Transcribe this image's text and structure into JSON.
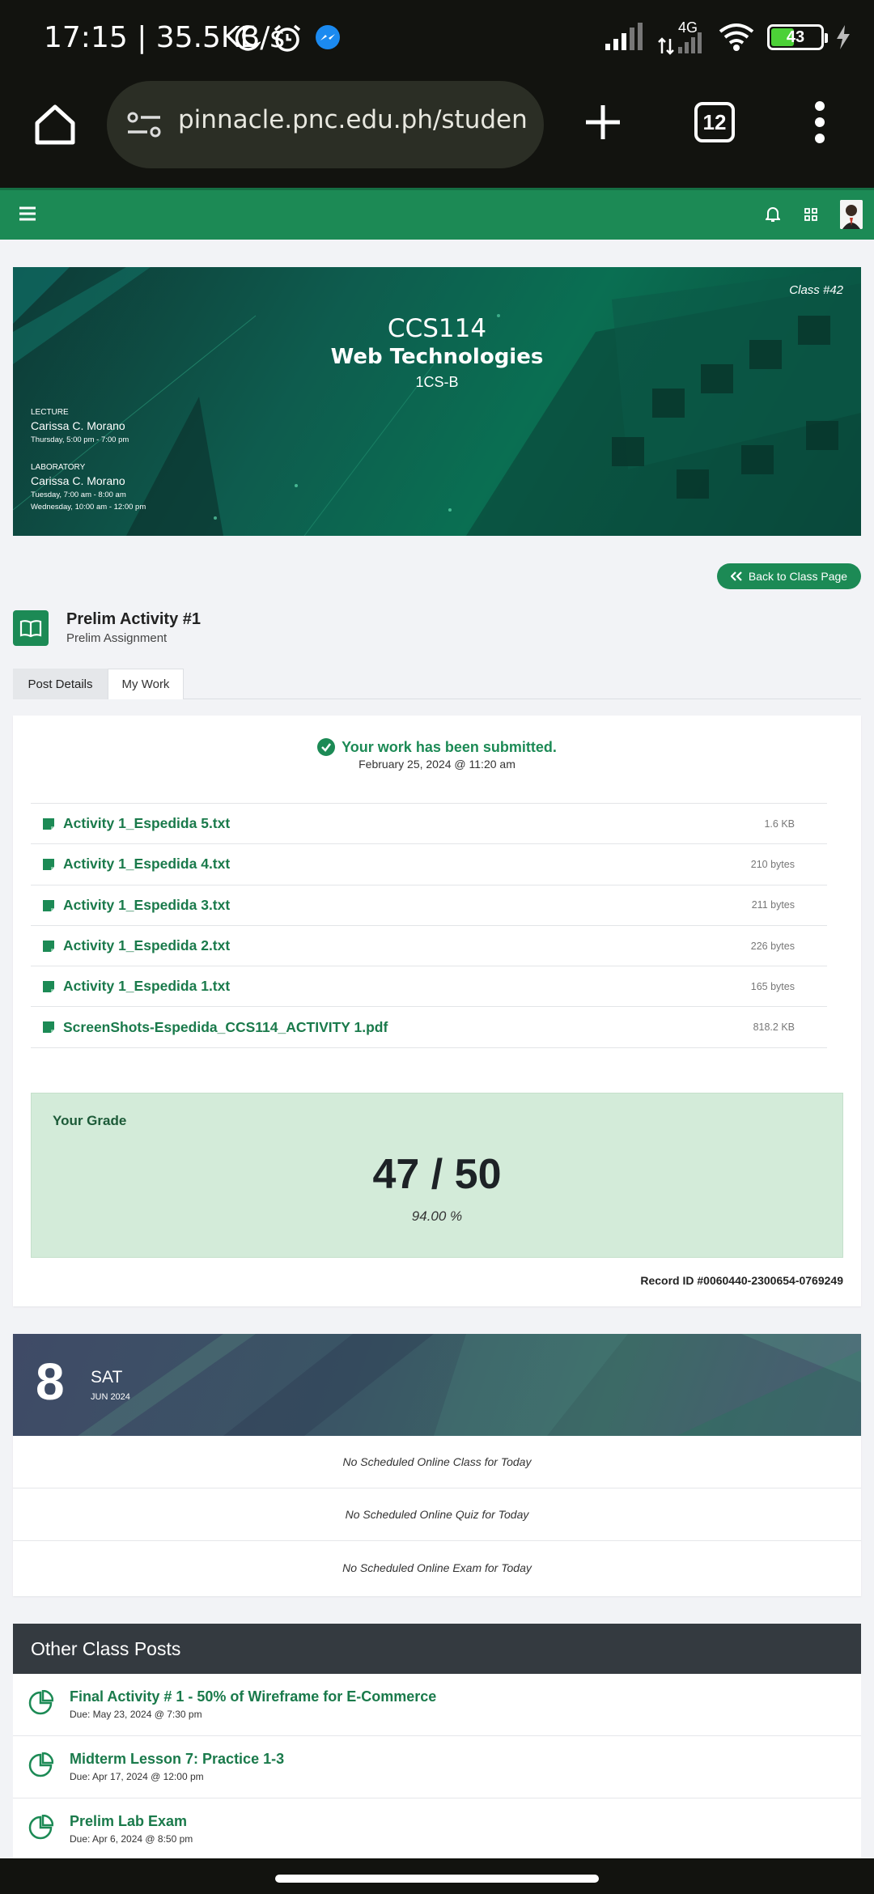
{
  "status_bar": {
    "time_speed": "17:15 | 35.5KB/s",
    "network": "4G",
    "battery": "43"
  },
  "browser": {
    "url": "pinnacle.pnc.edu.ph/student/pos",
    "tab_count": "12"
  },
  "banner": {
    "class_number": "Class #42",
    "course_code": "CCS114",
    "course_title": "Web Technologies",
    "section": "1CS-B",
    "lecture_label": "LECTURE",
    "lecture_teacher": "Carissa C. Morano",
    "lecture_schedule": "Thursday, 5:00 pm - 7:00 pm",
    "lab_label": "LABORATORY",
    "lab_teacher": "Carissa C. Morano",
    "lab_schedule_1": "Tuesday, 7:00 am - 8:00 am",
    "lab_schedule_2": "Wednesday, 10:00 am - 12:00 pm"
  },
  "back_button": "Back to Class Page",
  "activity": {
    "title": "Prelim Activity #1",
    "subtitle": "Prelim Assignment"
  },
  "tabs": [
    "Post Details",
    "My Work"
  ],
  "submission": {
    "status": "Your work has been submitted.",
    "date": "February 25, 2024 @ 11:20 am",
    "files": [
      {
        "name": "Activity 1_Espedida 5.txt",
        "size": "1.6 KB"
      },
      {
        "name": "Activity 1_Espedida 4.txt",
        "size": "210 bytes"
      },
      {
        "name": "Activity 1_Espedida 3.txt",
        "size": "211 bytes"
      },
      {
        "name": "Activity 1_Espedida 2.txt",
        "size": "226 bytes"
      },
      {
        "name": "Activity 1_Espedida 1.txt",
        "size": "165 bytes"
      },
      {
        "name": "ScreenShots-Espedida_CCS114_ACTIVITY 1.pdf",
        "size": "818.2 KB"
      }
    ]
  },
  "grade": {
    "label": "Your Grade",
    "score": "47 / 50",
    "percent": "94.00 %",
    "record_id": "Record ID #0060440-2300654-0769249"
  },
  "today": {
    "day_number": "8",
    "weekday": "SAT",
    "month_year": "JUN 2024",
    "items": [
      "No Scheduled Online Class for Today",
      "No Scheduled Online Quiz for Today",
      "No Scheduled Online Exam for Today"
    ]
  },
  "other_posts": {
    "header": "Other Class Posts",
    "posts": [
      {
        "title": "Final Activity # 1 - 50% of Wireframe for E-Commerce",
        "due": "Due: May 23, 2024 @ 7:30 pm"
      },
      {
        "title": "Midterm Lesson 7: Practice 1-3",
        "due": "Due: Apr 17, 2024 @ 12:00 pm"
      },
      {
        "title": "Prelim Lab Exam",
        "due": "Due: Apr 6, 2024 @ 8:50 pm"
      }
    ]
  },
  "colors": {
    "brand_green": "#1c8a55",
    "dark_header": "#343a40",
    "grade_bg": "#d3ebd9"
  }
}
